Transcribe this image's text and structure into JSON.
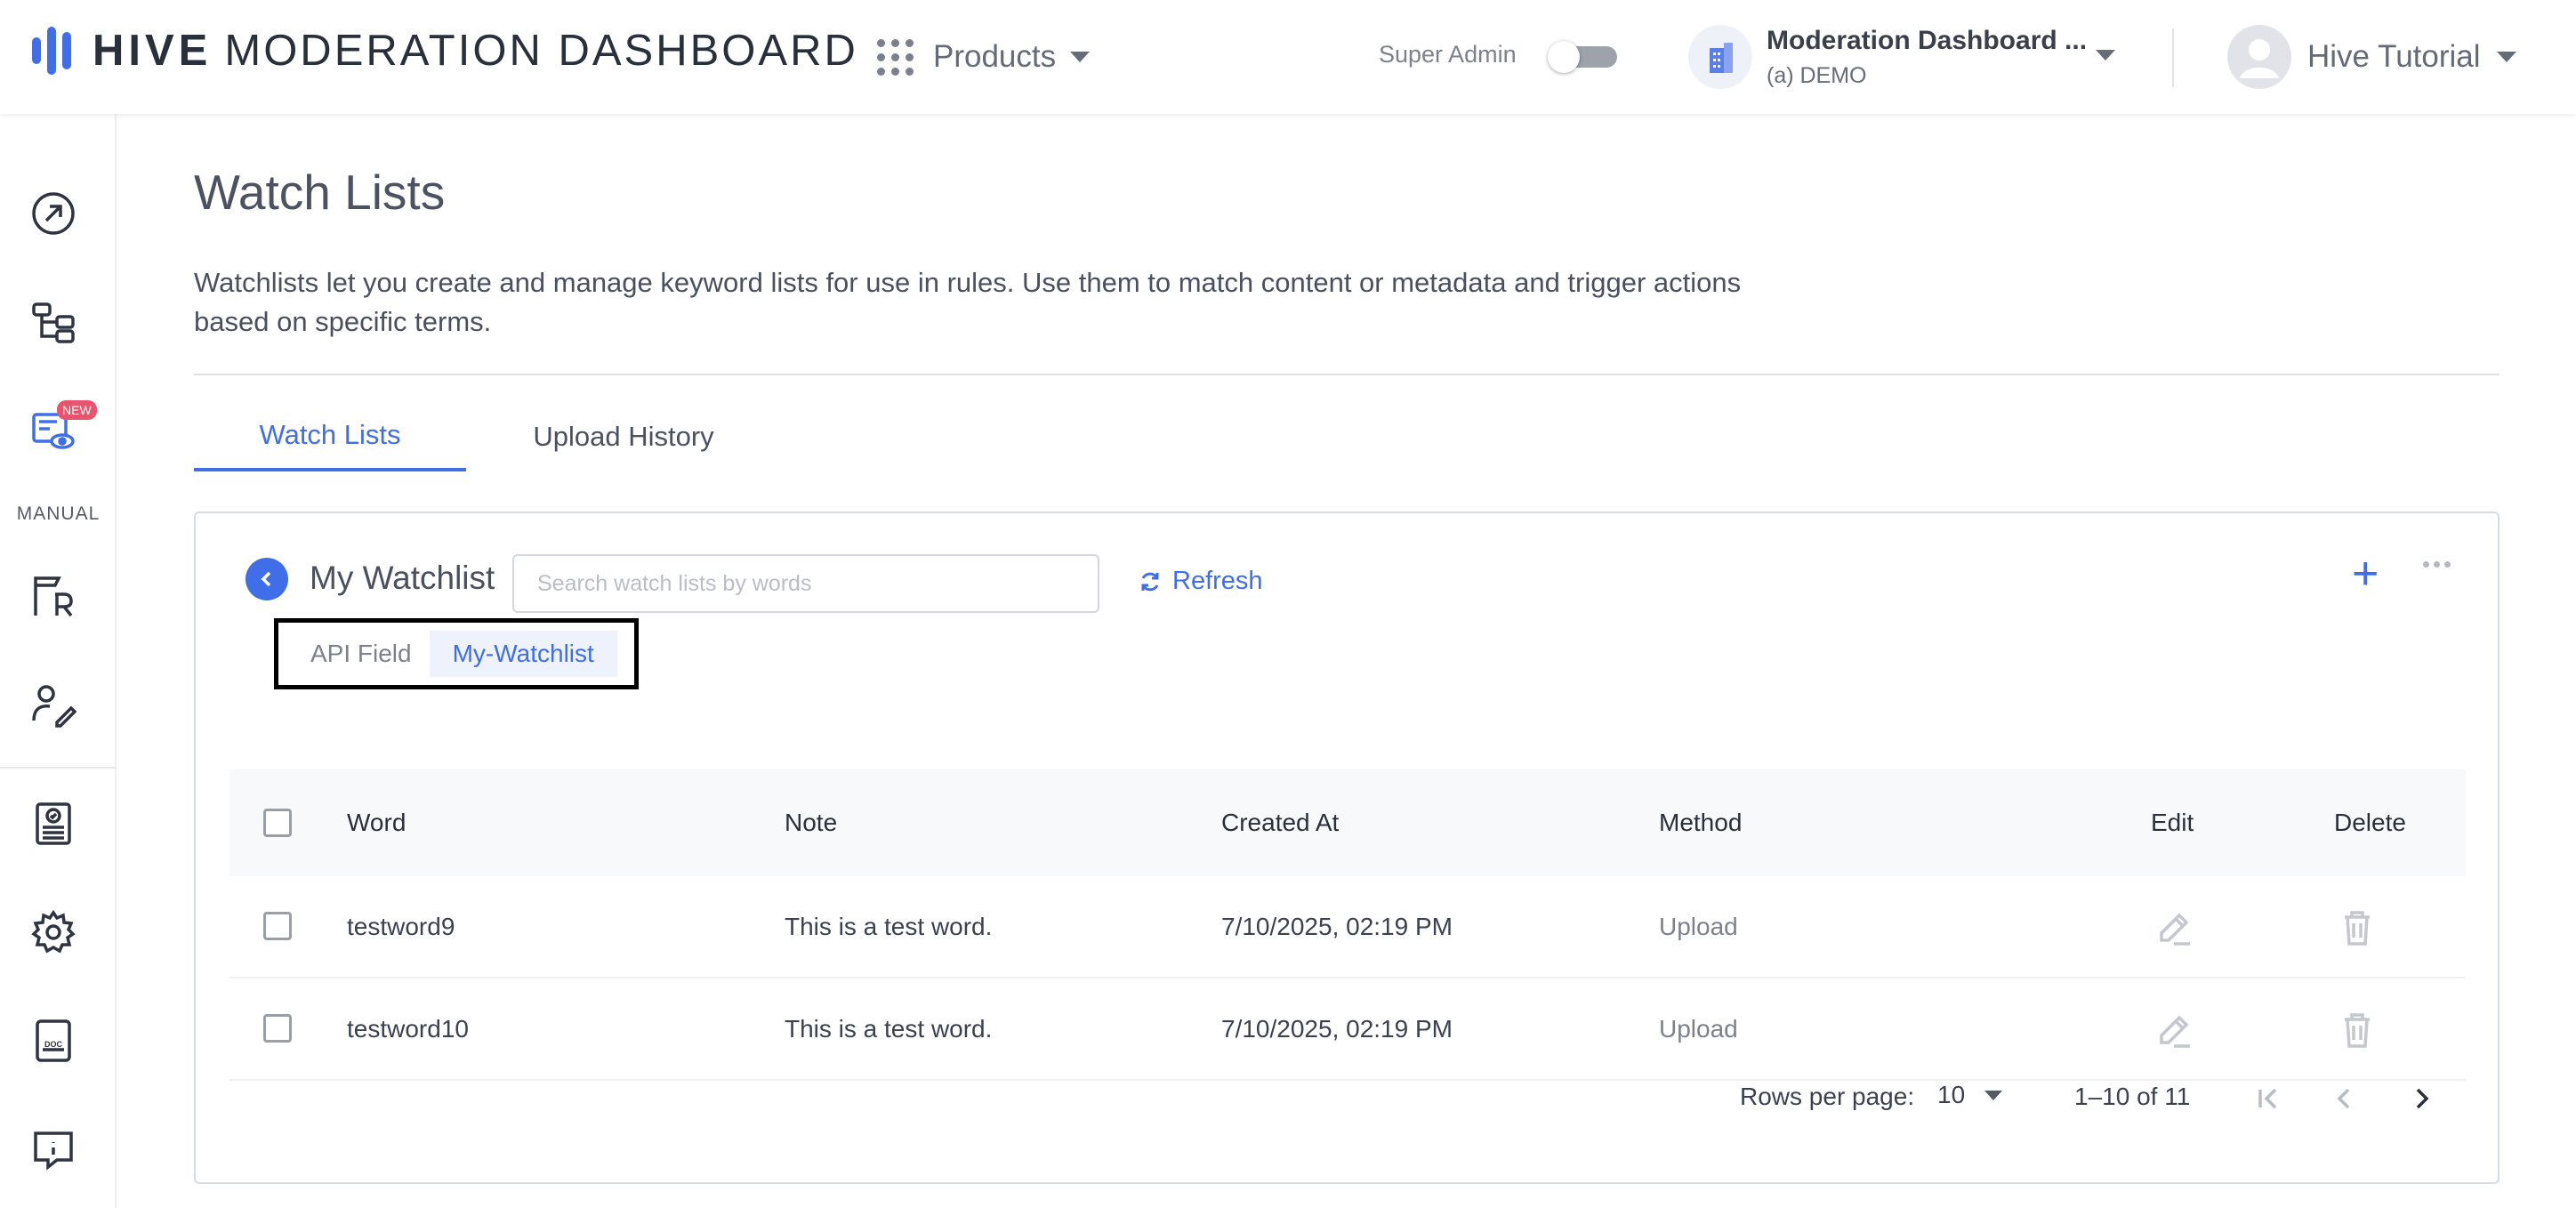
{
  "header": {
    "logo_brand": "HIVE",
    "logo_suffix": "MODERATION DASHBOARD",
    "products_label": "Products",
    "super_admin_label": "Super Admin",
    "org_name": "Moderation Dashboard ...",
    "org_sub": "(a) DEMO",
    "user_name": "Hive Tutorial"
  },
  "sidebar": {
    "items": [
      {
        "icon": "arrow-circle-icon"
      },
      {
        "icon": "flow-icon"
      },
      {
        "icon": "eye-list-icon",
        "badge": "NEW"
      },
      {
        "icon": "review-flag-icon"
      },
      {
        "icon": "user-edit-icon"
      },
      {
        "icon": "report-icon"
      },
      {
        "icon": "gear-icon"
      },
      {
        "icon": "doc-icon"
      },
      {
        "icon": "info-chat-icon"
      }
    ],
    "section_label": "MANUAL"
  },
  "page": {
    "title": "Watch Lists",
    "description": "Watchlists let you create and manage keyword lists for use in rules. Use them to match content or metadata and trigger actions based on specific terms."
  },
  "tabs": [
    {
      "label": "Watch Lists",
      "active": true
    },
    {
      "label": "Upload History",
      "active": false
    }
  ],
  "watchlist": {
    "name": "My Watchlist",
    "search_placeholder": "Search watch lists by words",
    "refresh_label": "Refresh",
    "api_field_label": "API Field",
    "api_field_value": "My-Watchlist"
  },
  "table": {
    "columns": [
      "Word",
      "Note",
      "Created At",
      "Method",
      "Edit",
      "Delete"
    ],
    "rows": [
      {
        "word": "testword9",
        "note": "This is a test word.",
        "created_at": "7/10/2025, 02:19 PM",
        "method": "Upload"
      },
      {
        "word": "testword10",
        "note": "This is a test word.",
        "created_at": "7/10/2025, 02:19 PM",
        "method": "Upload"
      }
    ]
  },
  "pagination": {
    "rows_per_page_label": "Rows per page:",
    "rows_per_page_value": "10",
    "range_text": "1–10 of 11"
  },
  "colors": {
    "accent": "#3f6ee8",
    "badge": "#e8546b"
  }
}
